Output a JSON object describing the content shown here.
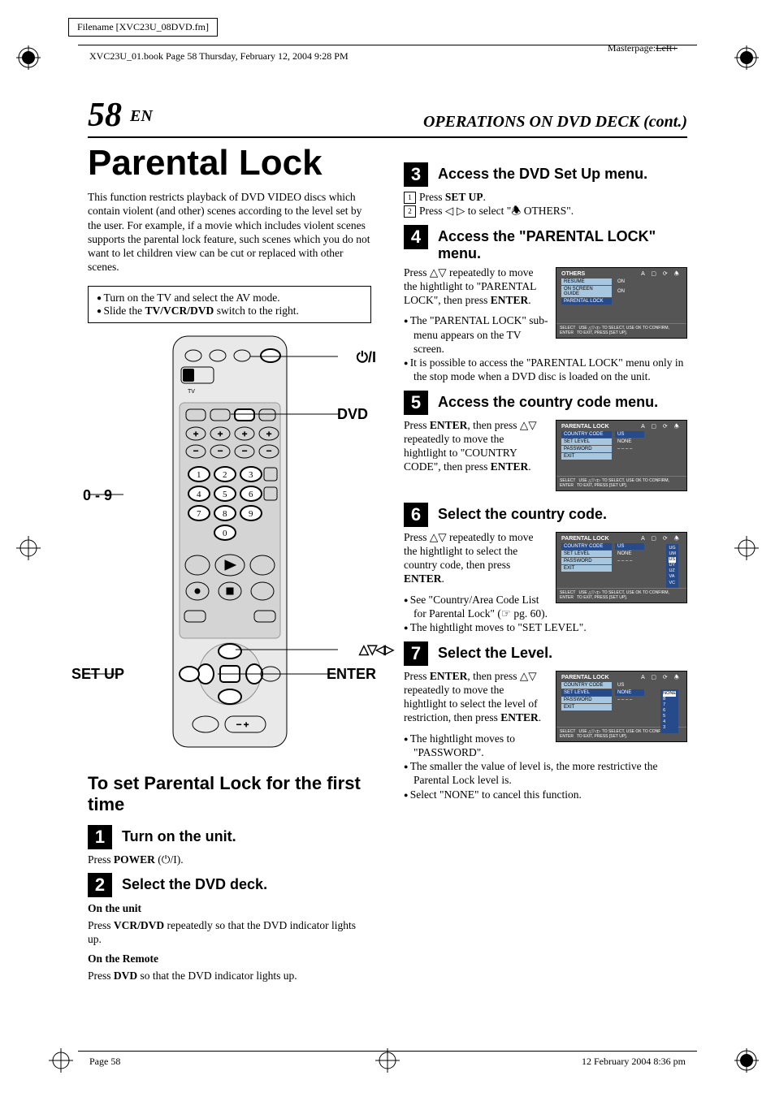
{
  "meta": {
    "filename_label": "Filename [XVC23U_08DVD.fm]",
    "header_line": "XVC23U_01.book  Page 58  Thursday, February 12, 2004  9:28 PM",
    "masterpage_label": "Masterpage:",
    "masterpage_value": "Left+",
    "footer_left": "Page 58",
    "footer_right": "12 February 2004 8:36 pm"
  },
  "page": {
    "number": "58",
    "lang": "EN",
    "section_title": "OPERATIONS ON DVD DECK (cont.)",
    "title": "Parental Lock",
    "intro": "This function restricts playback of DVD VIDEO discs which contain violent (and other) scenes according to the level set by the user. For example, if a movie which includes violent scenes supports the parental lock feature, such scenes which you do not want to let children view can be cut or replaced with other scenes.",
    "prep_bullets": [
      "Turn on the TV and select the AV mode.",
      "Slide the TV/VCR/DVD switch to the right."
    ],
    "remote_labels": {
      "power": "⏻/I",
      "dvd": "DVD",
      "numbers": "0 - 9",
      "arrows": "△▽◁▷",
      "enter": "ENTER",
      "setup": "SET UP"
    },
    "h2_first": "To set Parental Lock for the first time",
    "steps_left": [
      {
        "n": "1",
        "title": "Turn on the unit.",
        "body": "Press POWER (⏻/I)."
      },
      {
        "n": "2",
        "title": "Select the DVD deck.",
        "sub1_h": "On the unit",
        "sub1_b": "Press VCR/DVD repeatedly so that the DVD indicator lights up.",
        "sub2_h": "On the Remote",
        "sub2_b": "Press DVD so that the DVD indicator lights up."
      }
    ],
    "steps_right": [
      {
        "n": "3",
        "title": "Access the DVD Set Up menu.",
        "lines": [
          {
            "num": "1",
            "text": "Press SET UP."
          },
          {
            "num": "2",
            "text": "Press ◁ ▷ to select \"🕭 OTHERS\"."
          }
        ]
      },
      {
        "n": "4",
        "title": "Access the \"PARENTAL LOCK\" menu.",
        "body": "Press △▽ repeatedly to move the hightlight to \"PARENTAL LOCK\", then press ENTER.",
        "bullets": [
          "The \"PARENTAL LOCK\" sub-menu appears on the TV screen.",
          "It is possible to access the \"PARENTAL LOCK\" menu only in the stop mode when a DVD disc is loaded on the unit."
        ],
        "osd": {
          "title": "OTHERS",
          "rows": [
            {
              "label": "RESUME",
              "val": "ON",
              "style": "label"
            },
            {
              "label": "ON SCREEN GUIDE",
              "val": "ON",
              "style": "label"
            },
            {
              "label": "PARENTAL LOCK",
              "val": "",
              "style": "sel"
            }
          ],
          "foot": [
            "SELECT",
            "USE △▽◁▷ TO SELECT,  USE OK TO CONFIRM,",
            "ENTER",
            "TO EXIT, PRESS [SET UP]."
          ]
        }
      },
      {
        "n": "5",
        "title": "Access the country code menu.",
        "body": "Press ENTER, then press △▽ repeatedly to move the hightlight to \"COUNTRY CODE\", then press ENTER.",
        "osd": {
          "title": "PARENTAL LOCK",
          "rows": [
            {
              "label": "COUNTRY CODE",
              "val": "US",
              "style": "sel",
              "valstyle": "valbox"
            },
            {
              "label": "SET LEVEL",
              "val": "NONE",
              "style": "label"
            },
            {
              "label": "PASSWORD",
              "val": "– – – –",
              "style": "label"
            },
            {
              "label": "EXIT",
              "val": "",
              "style": "label"
            }
          ],
          "foot": [
            "SELECT",
            "USE △▽◁▷ TO SELECT,  USE OK TO CONFIRM,",
            "ENTER",
            "TO EXIT, PRESS [SET UP]."
          ]
        }
      },
      {
        "n": "6",
        "title": "Select the country code.",
        "body": "Press △▽ repeatedly to move the hightlight to select the country code, then press ENTER.",
        "bullets": [
          "See \"Country/Area Code List for Parental Lock\" (☞ pg. 60).",
          "The hightlight moves to \"SET LEVEL\"."
        ],
        "osd": {
          "title": "PARENTAL LOCK",
          "rows": [
            {
              "label": "COUNTRY CODE",
              "val": "US",
              "style": "sel",
              "valstyle": "valbox"
            },
            {
              "label": "SET LEVEL",
              "val": "NONE",
              "style": "label"
            },
            {
              "label": "PASSWORD",
              "val": "– – – –",
              "style": "label"
            },
            {
              "label": "EXIT",
              "val": "",
              "style": "label"
            }
          ],
          "pop": [
            "UG",
            "UM",
            "US",
            "UY",
            "UZ",
            "VA",
            "VC"
          ],
          "foot": [
            "SELECT",
            "USE △▽◁▷ TO SELECT,  USE OK TO CONFIRM,",
            "ENTER",
            "TO EXIT, PRESS [SET UP]."
          ]
        }
      },
      {
        "n": "7",
        "title": "Select the Level.",
        "body": "Press ENTER, then press △▽ repeatedly to move the hightlight to select the level of restriction, then press ENTER.",
        "bullets": [
          "The hightlight moves to \"PASSWORD\".",
          "The smaller the value of level is, the more restrictive the Parental Lock level is.",
          "Select \"NONE\" to cancel this function."
        ],
        "osd": {
          "title": "PARENTAL LOCK",
          "rows": [
            {
              "label": "COUNTRY CODE",
              "val": "US",
              "style": "label"
            },
            {
              "label": "SET LEVEL",
              "val": "NONE",
              "style": "sel",
              "valstyle": "valbox"
            },
            {
              "label": "PASSWORD",
              "val": "– – – –",
              "style": "label"
            },
            {
              "label": "EXIT",
              "val": "",
              "style": "label"
            }
          ],
          "pop": [
            "NONE",
            "8",
            "7",
            "6",
            "5",
            "4",
            "3"
          ],
          "foot": [
            "SELECT",
            "USE △▽◁▷ TO SELECT,  USE OK TO CONFIRM,",
            "ENTER",
            "TO EXIT, PRESS [SET UP]."
          ]
        }
      }
    ]
  }
}
